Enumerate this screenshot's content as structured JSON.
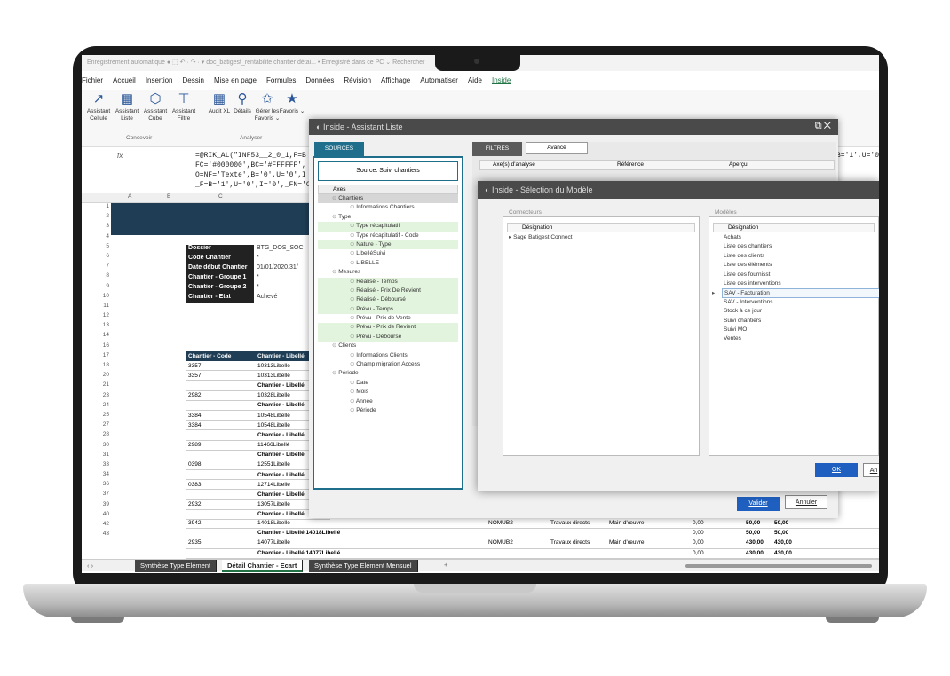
{
  "titlebar": {
    "text": "Enregistrement automatique ● ⬚ ↶ · ↷ · ▾    doc_batigest_rentabilite chantier détai...  •  Enregistré dans ce PC  ⌄      Rechercher"
  },
  "menu": [
    "Fichier",
    "Accueil",
    "Insertion",
    "Dessin",
    "Mise en page",
    "Formules",
    "Données",
    "Révision",
    "Affichage",
    "Automatiser",
    "Aide",
    "Inside"
  ],
  "menu_active": "Inside",
  "ribbon": {
    "buttons": [
      {
        "label": "Assistant Cellule",
        "icon": "↗"
      },
      {
        "label": "Assistant Liste",
        "icon": "▦"
      },
      {
        "label": "Assistant Cube",
        "icon": "⬡"
      },
      {
        "label": "Assistant Filtre",
        "icon": "⊤"
      },
      {
        "label": "Audit XL",
        "icon": "▦"
      },
      {
        "label": "Détails",
        "icon": "⚲"
      },
      {
        "label": "Gérer les Favoris ⌄",
        "icon": "✩"
      },
      {
        "label": "Favoris ⌄",
        "icon": "★"
      }
    ],
    "groups": [
      "Concevoir",
      "Analyser"
    ]
  },
  "formula": {
    "fx": "fx",
    "lines": [
      "=@RIK_AL(\"INF53__2_0_1,F=B",
      "FC='#000000',BC='#FFFFFF',",
      "O=NF='Texte',B='0',U='0',I",
      "_F=B='1',U='0',I='0',_FN='C"
    ],
    "right": "B='1',U='0'"
  },
  "columns": [
    "A",
    "B",
    "C"
  ],
  "rownums": [
    "1",
    "2",
    "3",
    "4",
    "5",
    "6",
    "7",
    "8",
    "9",
    "10",
    "11",
    "12",
    "13",
    "14",
    "16",
    "17",
    "18",
    "20",
    "21",
    "23",
    "24",
    "25",
    "27",
    "28",
    "30",
    "31",
    "33",
    "34",
    "36",
    "37",
    "39",
    "40",
    "42",
    "43"
  ],
  "info": [
    {
      "k": "Dossier",
      "v": "BTG_DOS_SOC"
    },
    {
      "k": "Code Chantier",
      "v": "*"
    },
    {
      "k": "Date début Chantier",
      "v": "01/01/2020.31/"
    },
    {
      "k": "Chantier - Groupe 1",
      "v": "*"
    },
    {
      "k": "Chantier - Groupe 2",
      "v": "*"
    },
    {
      "k": "Chantier - Etat",
      "v": "Achevé"
    }
  ],
  "table": {
    "headers": [
      "Chantier - Code",
      "Chantier - Libellé"
    ],
    "rows": [
      [
        "3357",
        "10313Libellé"
      ],
      [
        "3357",
        "10313Libellé"
      ],
      [
        "",
        "Chantier - Libellé"
      ],
      [
        "2982",
        "10328Libellé"
      ],
      [
        "",
        "Chantier - Libellé"
      ],
      [
        "3384",
        "10548Libellé"
      ],
      [
        "3384",
        "10548Libellé"
      ],
      [
        "",
        "Chantier - Libellé"
      ],
      [
        "2989",
        "11466Libellé"
      ],
      [
        "",
        "Chantier - Libellé"
      ],
      [
        "0398",
        "12551Libellé"
      ],
      [
        "",
        "Chantier - Libellé"
      ],
      [
        "0383",
        "12714Libellé"
      ],
      [
        "",
        "Chantier - Libellé"
      ],
      [
        "2932",
        "13057Libellé"
      ],
      [
        "",
        "Chantier - Libellé"
      ]
    ]
  },
  "lower": [
    {
      "a": "3942",
      "b": "14018Libellé",
      "c": "NOMUB2",
      "d": "Travaux directs",
      "e": "Main d'œuvre",
      "f": "0,00",
      "g": "50,00",
      "h": "50,00"
    },
    {
      "a": "",
      "b": "Chantier - Libellé 14018Libellé",
      "c": "",
      "d": "",
      "e": "",
      "f": "0,00",
      "g": "50,00",
      "h": "50,00"
    },
    {
      "a": "2935",
      "b": "14077Libellé",
      "c": "NOMUB2",
      "d": "Travaux directs",
      "e": "Main d'œuvre",
      "f": "0,00",
      "g": "430,00",
      "h": "430,00"
    },
    {
      "a": "",
      "b": "Chantier - Libellé 14077Libellé",
      "c": "",
      "d": "",
      "e": "",
      "f": "0,00",
      "g": "430,00",
      "h": "430,00"
    }
  ],
  "sheets": [
    "Synthèse Type Elément",
    "Détail Chantier - Ecart",
    "Synthèse Type Elément Mensuel"
  ],
  "assistant": {
    "title": "Inside - Assistant Liste",
    "sources_tab": "SOURCES",
    "source_title": "Source: Suivi chantiers",
    "axes_header": "Axes",
    "tree": [
      {
        "t": "Chantiers",
        "l": 1,
        "g": false,
        "hl": true
      },
      {
        "t": "Informations Chantiers",
        "l": 2,
        "g": false
      },
      {
        "t": "Type",
        "l": 1,
        "g": false
      },
      {
        "t": "Type récapitulatif",
        "l": 2,
        "g": true
      },
      {
        "t": "Type récapitulatif - Code",
        "l": 2,
        "g": false
      },
      {
        "t": "Nature - Type",
        "l": 2,
        "g": true
      },
      {
        "t": "LibelléSuivi",
        "l": 2,
        "g": false
      },
      {
        "t": "LIBELLE",
        "l": 2,
        "g": false
      },
      {
        "t": "Mesures",
        "l": 1,
        "g": false
      },
      {
        "t": "Réalisé - Temps",
        "l": 2,
        "g": true
      },
      {
        "t": "Réalisé - Prix De Revient",
        "l": 2,
        "g": true
      },
      {
        "t": "Réalisé - Déboursé",
        "l": 2,
        "g": true
      },
      {
        "t": "Prévu - Temps",
        "l": 2,
        "g": true
      },
      {
        "t": "Prévu - Prix de Vente",
        "l": 2,
        "g": false
      },
      {
        "t": "Prévu - Prix de Revient",
        "l": 2,
        "g": true
      },
      {
        "t": "Prévu - Déboursé",
        "l": 2,
        "g": true
      },
      {
        "t": "Clients",
        "l": 1,
        "g": false
      },
      {
        "t": "Informations Clients",
        "l": 2,
        "g": false
      },
      {
        "t": "Champ migration Access",
        "l": 2,
        "g": false
      },
      {
        "t": "Période",
        "l": 1,
        "g": false
      },
      {
        "t": "Date",
        "l": 2,
        "g": false
      },
      {
        "t": "Mois",
        "l": 2,
        "g": false
      },
      {
        "t": "Année",
        "l": 2,
        "g": false
      },
      {
        "t": "Période",
        "l": 2,
        "g": false
      }
    ],
    "filtres_tab": "FILTRES",
    "avance_tab": "Avancé",
    "grid_headers": [
      "Axe(s) d'analyse",
      "Référence",
      "Aperçu"
    ],
    "valider": "Valider",
    "annuler": "Annuler"
  },
  "modele": {
    "title": "Inside - Sélection du Modèle",
    "connecteurs_legend": "Connecteurs",
    "modeles_legend": "Modèles",
    "designation": "Désignation",
    "connecteurs": [
      "Sage Batigest Connect"
    ],
    "modeles": [
      "Achats",
      "Liste des chantiers",
      "Liste des clients",
      "Liste des éléments",
      "Liste des fournisst",
      "Liste des interventions",
      "SAV - Facturation",
      "SAV - Interventions",
      "Stock à ce jour",
      "Suivi chantiers",
      "Suivi MO",
      "Ventes"
    ],
    "selected": "SAV - Facturation",
    "ok": "OK",
    "annuler_short": "An"
  }
}
